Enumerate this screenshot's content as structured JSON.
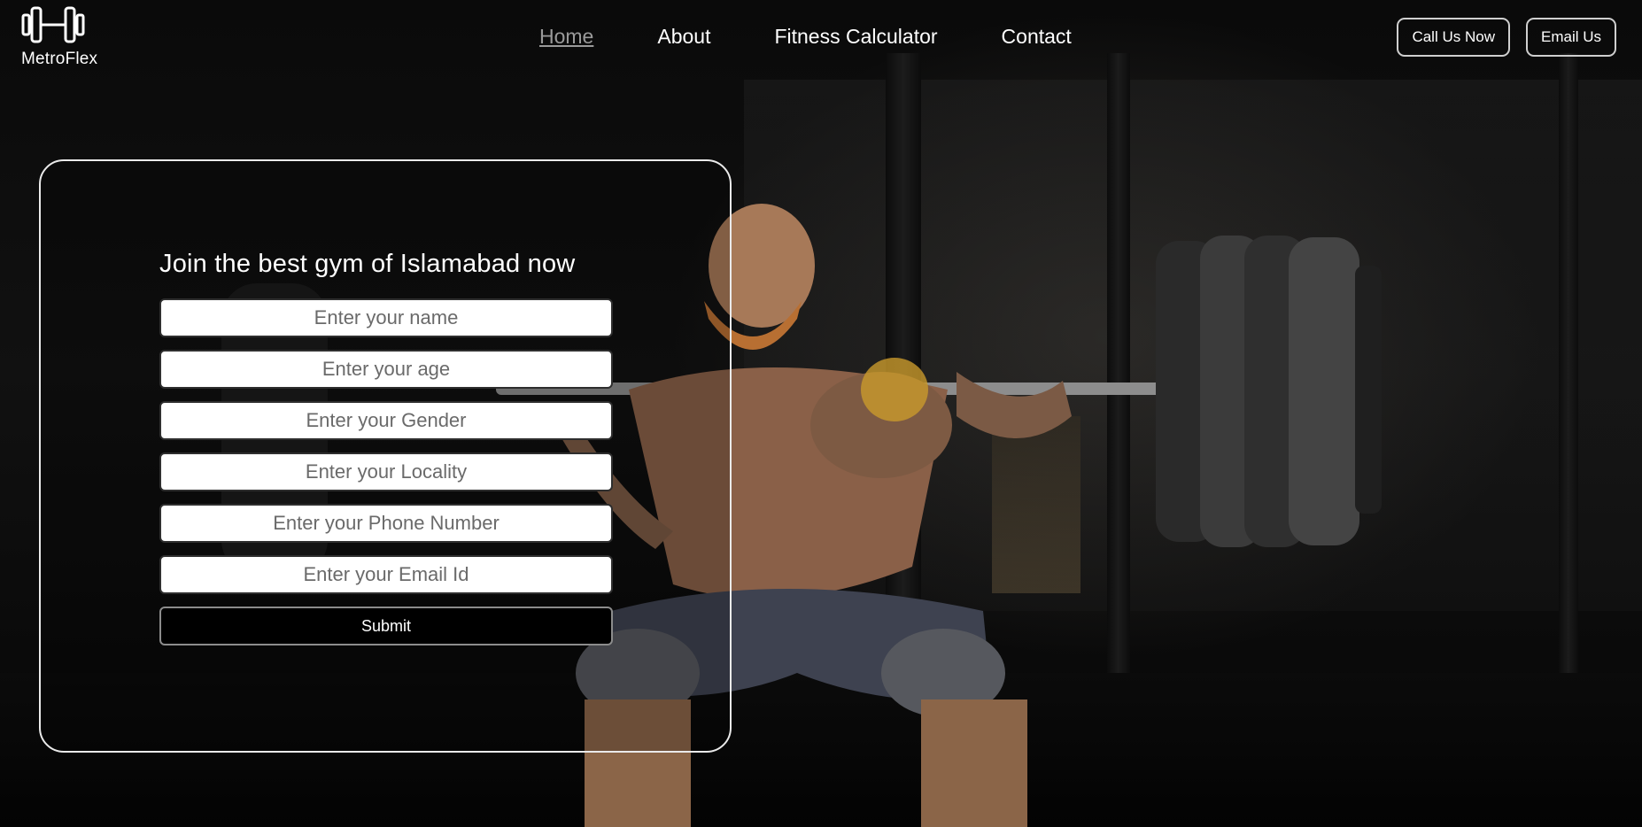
{
  "brand": {
    "name": "MetroFlex",
    "icon": "dumbbell-icon"
  },
  "nav": {
    "items": [
      {
        "label": "Home",
        "active": true
      },
      {
        "label": "About",
        "active": false
      },
      {
        "label": "Fitness Calculator",
        "active": false
      },
      {
        "label": "Contact",
        "active": false
      }
    ]
  },
  "header_buttons": {
    "call": "Call Us Now",
    "email": "Email Us"
  },
  "form": {
    "heading": "Join the best gym of Islamabad now",
    "fields": {
      "name": {
        "placeholder": "Enter your name",
        "value": ""
      },
      "age": {
        "placeholder": "Enter your age",
        "value": ""
      },
      "gender": {
        "placeholder": "Enter your Gender",
        "value": ""
      },
      "locality": {
        "placeholder": "Enter your Locality",
        "value": ""
      },
      "phone": {
        "placeholder": "Enter your Phone Number",
        "value": ""
      },
      "email": {
        "placeholder": "Enter your Email Id",
        "value": ""
      }
    },
    "submit_label": "Submit"
  },
  "colors": {
    "background": "#060606",
    "text": "#ffffff",
    "nav_active": "#9a9a9a",
    "card_border": "#eaeaea",
    "submit_bg": "#000000"
  }
}
